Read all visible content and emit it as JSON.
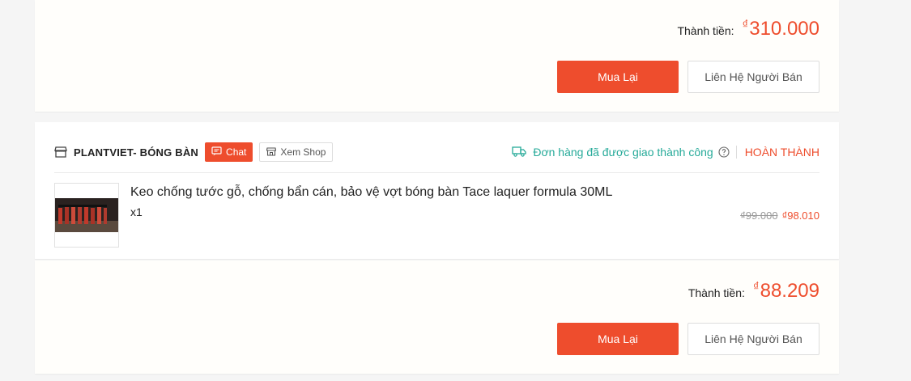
{
  "order1": {
    "total_label": "Thành tiền:",
    "total_currency": "₫",
    "total_value": "310.000",
    "rebuy_label": "Mua Lại",
    "contact_label": "Liên Hệ Người Bán"
  },
  "order2": {
    "shop_name": "PLANTVIET- BÓNG BÀN",
    "chat_label": "Chat",
    "view_shop_label": "Xem Shop",
    "delivery_status": "Đơn hàng đã được giao thành công",
    "order_status": "HOÀN THÀNH",
    "product": {
      "name": "Keo chống tước gỗ, chống bẩn cán, bảo vệ vợt bóng bàn Tace laquer formula 30ML",
      "quantity": "x1",
      "original_price": "₫99.000",
      "price": "₫98.010"
    },
    "total_label": "Thành tiền:",
    "total_currency": "₫",
    "total_value": "88.209",
    "rebuy_label": "Mua Lại",
    "contact_label": "Liên Hệ Người Bán"
  },
  "colors": {
    "accent": "#ee4d2d",
    "success": "#26aa99",
    "card_bg": "#fffefb",
    "page_bg": "#f5f5f5"
  },
  "icons": {
    "shop": "shop-icon",
    "chat": "chat-icon",
    "view_shop": "store-icon",
    "truck": "truck-icon",
    "help": "help-icon"
  }
}
